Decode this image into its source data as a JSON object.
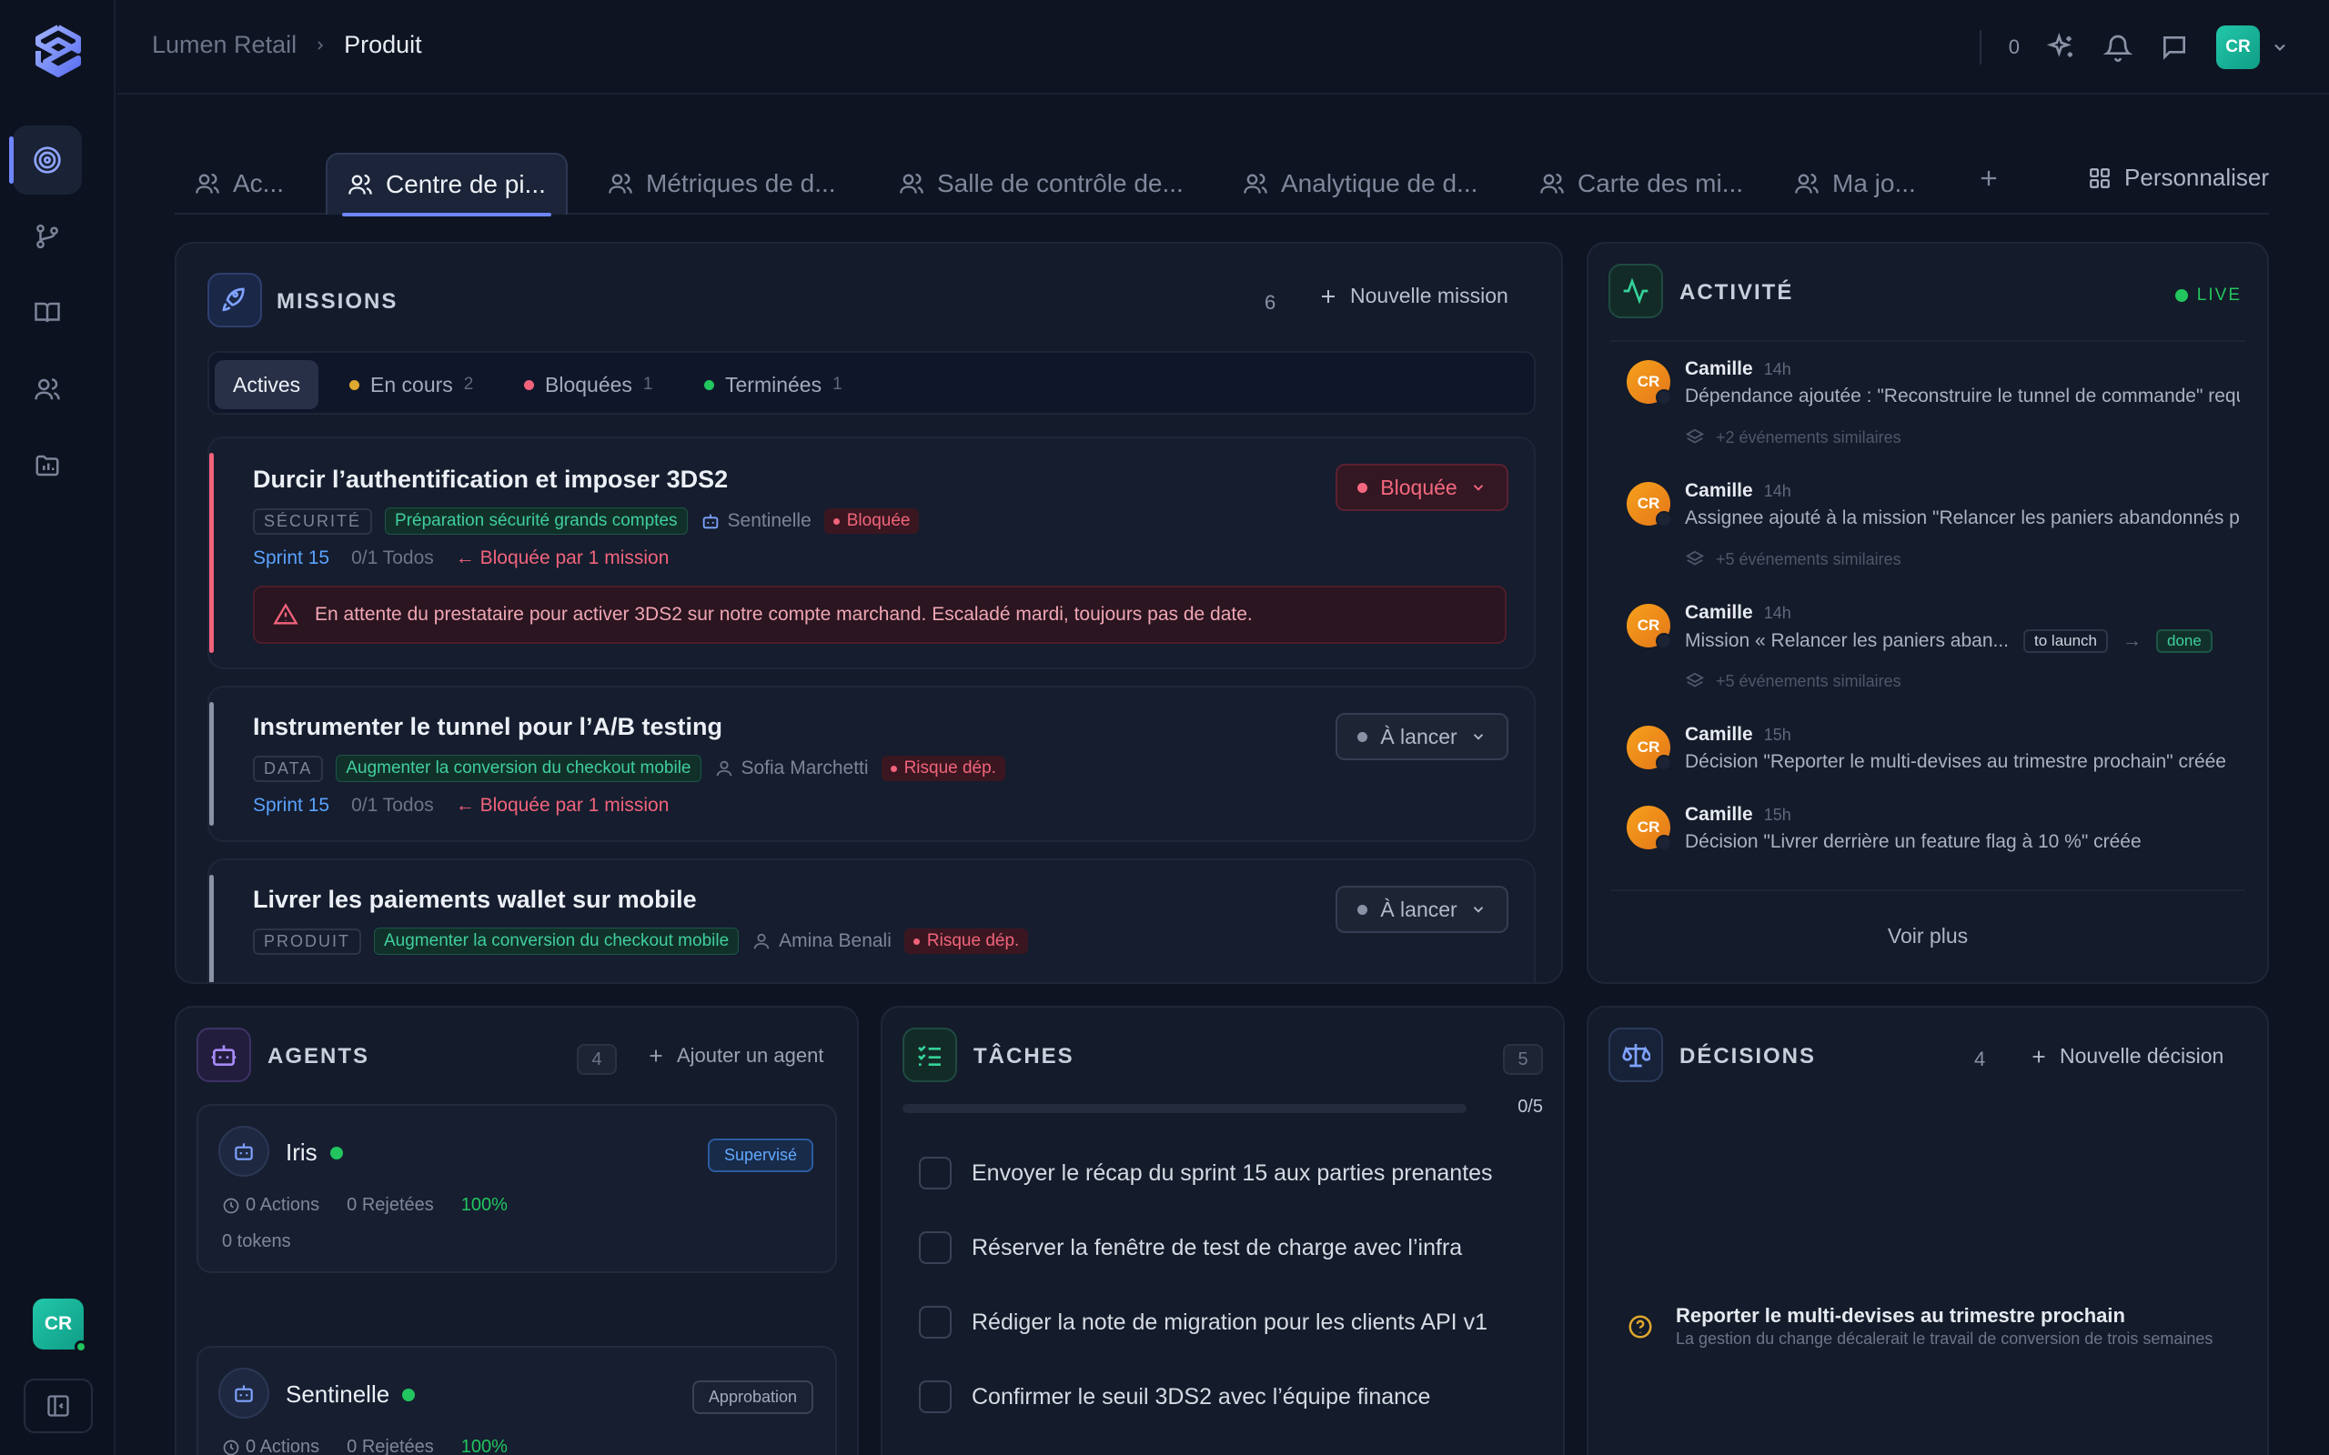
{
  "header": {
    "breadcrumb": [
      "Lumen Retail",
      "Produit"
    ],
    "notification_count": "0",
    "user_initials": "CR"
  },
  "sidebar": {
    "user_initials": "CR",
    "items": [
      "target-icon",
      "branch-icon",
      "book-icon",
      "users-icon",
      "folder-chart-icon"
    ]
  },
  "tabs": [
    "Ac...",
    "Centre de pi...",
    "Métriques de d...",
    "Salle de contrôle de...",
    "Analytique de d...",
    "Carte des mi...",
    "Ma jo..."
  ],
  "personalize_label": "Personnaliser",
  "missions": {
    "title": "MISSIONS",
    "count": "6",
    "new_label": "Nouvelle mission",
    "filters": [
      {
        "label": "Actives",
        "count": "",
        "color": ""
      },
      {
        "label": "En cours",
        "count": "2",
        "color": "#e0a82e"
      },
      {
        "label": "Bloquées",
        "count": "1",
        "color": "#f1637b"
      },
      {
        "label": "Terminées",
        "count": "1",
        "color": "#22c55e"
      }
    ],
    "cards": [
      {
        "title": "Durcir l’authentification et imposer 3DS2",
        "category": "SÉCURITÉ",
        "goal": "Préparation sécurité grands comptes",
        "owner": "Sentinelle",
        "risk": "Bloquée",
        "sprint": "Sprint 15",
        "todos": "0/1 Todos",
        "blocked_by": "Bloquée par 1 mission",
        "status": "Bloquée",
        "warning": "En attente du prestataire pour activer 3DS2 sur notre compte marchand. Escaladé mardi, toujours pas de date."
      },
      {
        "title": "Instrumenter le tunnel pour l’A/B testing",
        "category": "DATA",
        "goal": "Augmenter la conversion du checkout mobile",
        "owner": "Sofia Marchetti",
        "risk": "Risque dép.",
        "sprint": "Sprint 15",
        "todos": "0/1 Todos",
        "blocked_by": "Bloquée par 1 mission",
        "status": "À lancer"
      },
      {
        "title": "Livrer les paiements wallet sur mobile",
        "category": "PRODUIT",
        "goal": "Augmenter la conversion du checkout mobile",
        "owner": "Amina Benali",
        "risk": "Risque dép.",
        "status": "À lancer"
      }
    ]
  },
  "activity": {
    "title": "ACTIVITÉ",
    "live_label": "LIVE",
    "items": [
      {
        "name": "Camille",
        "time": "14h",
        "text": "Dépendance ajoutée : \"Reconstruire le tunnel de commande\" requise pour",
        "similar": "+2 événements similaires"
      },
      {
        "name": "Camille",
        "time": "14h",
        "text": "Assignee ajouté à la mission \"Relancer les paniers abandonnés par SMS\"",
        "similar": "+5 événements similaires"
      },
      {
        "name": "Camille",
        "time": "14h",
        "text": "Mission « Relancer les paniers aban...",
        "from": "to launch",
        "to": "done",
        "similar": "+5 événements similaires"
      },
      {
        "name": "Camille",
        "time": "15h",
        "text": "Décision \"Reporter le multi-devises au trimestre prochain\" créée"
      },
      {
        "name": "Camille",
        "time": "15h",
        "text": "Décision \"Livrer derrière un feature flag à 10 %\" créée"
      }
    ],
    "more_label": "Voir plus"
  },
  "agents": {
    "title": "AGENTS",
    "count": "4",
    "add_label": "Ajouter un agent",
    "list": [
      {
        "name": "Iris",
        "badge": "Supervisé",
        "actions": "0 Actions",
        "rejected": "0 Rejetées",
        "rate": "100%",
        "tokens": "0 tokens"
      },
      {
        "name": "Sentinelle",
        "badge": "Approbation",
        "actions": "0 Actions",
        "rejected": "0 Rejetées",
        "rate": "100%"
      }
    ]
  },
  "tasks": {
    "title": "TÂCHES",
    "count": "5",
    "progress_label": "0/5",
    "progress_fraction": 0,
    "items": [
      "Envoyer le récap du sprint 15 aux parties prenantes",
      "Réserver la fenêtre de test de charge avec l’infra",
      "Rédiger la note de migration pour les clients API v1",
      "Confirmer le seuil 3DS2 avec l’équipe finance"
    ]
  },
  "decisions": {
    "title": "DÉCISIONS",
    "count": "4",
    "new_label": "Nouvelle décision",
    "item": {
      "title": "Reporter le multi-devises au trimestre prochain",
      "subtitle": "La gestion du change décalerait le travail de conversion de trois semaines"
    }
  },
  "colors": {
    "accent": "#6f86ff",
    "green": "#22c55e",
    "red": "#f1637b",
    "bg": "#0f1422"
  }
}
